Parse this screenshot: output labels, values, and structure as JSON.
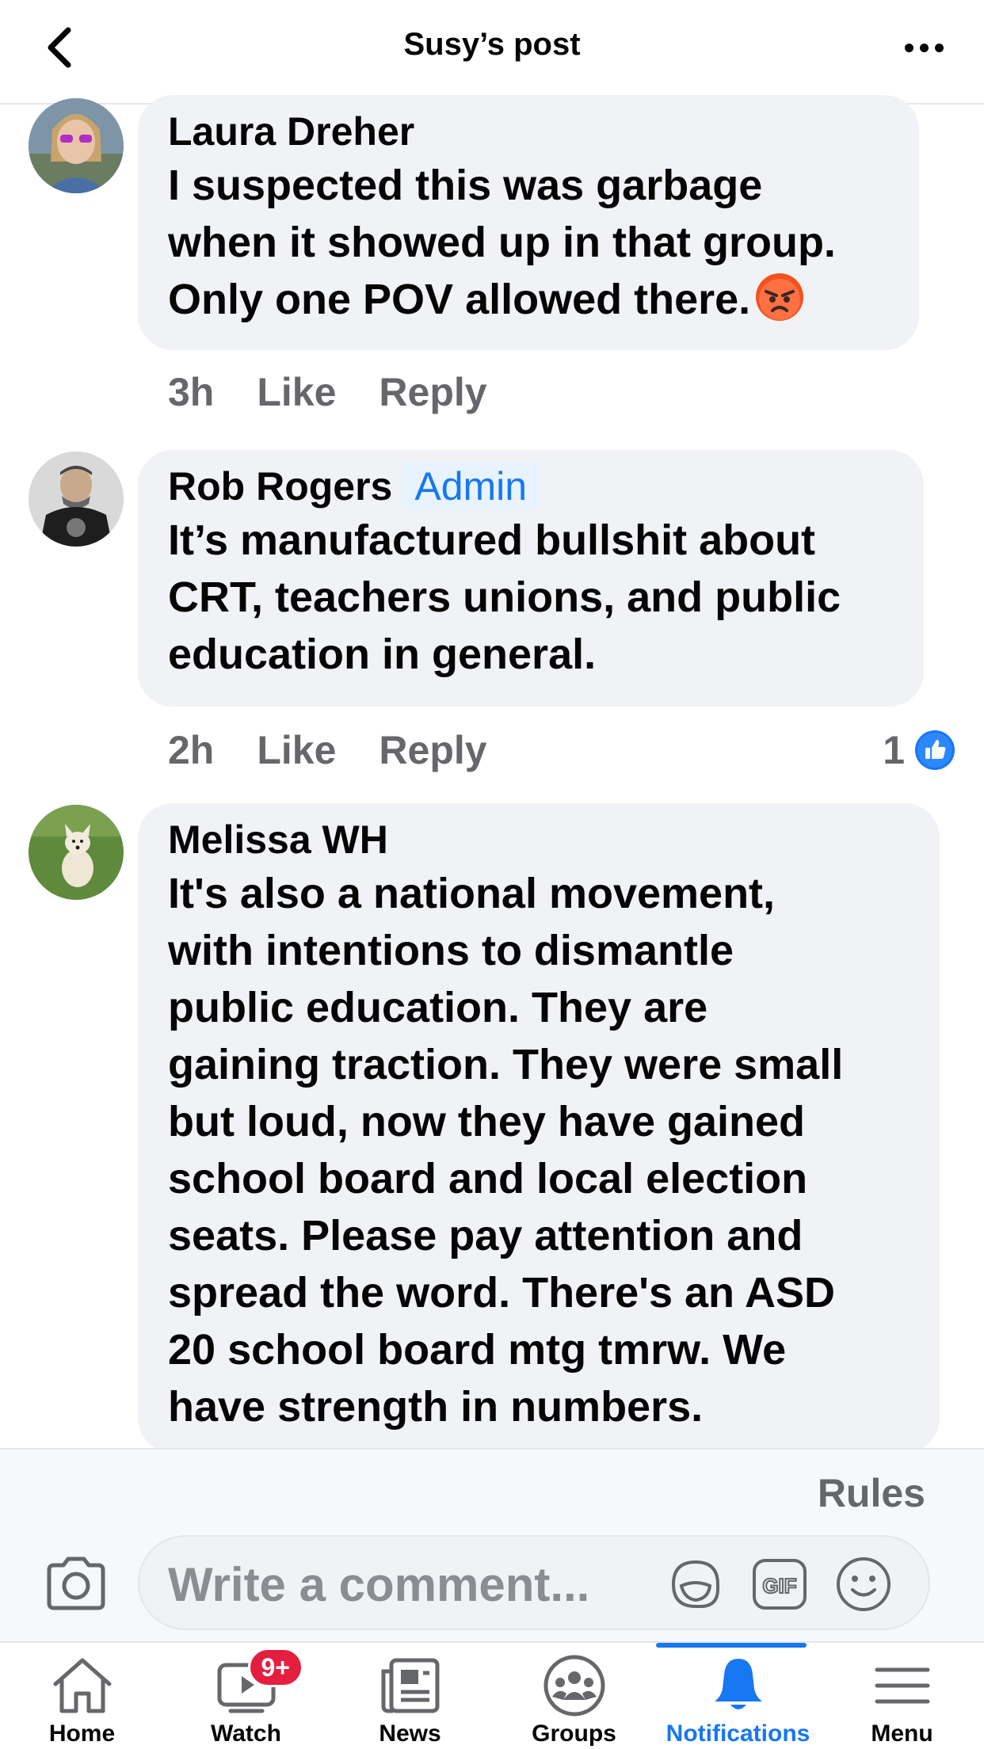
{
  "header": {
    "title": "Susy’s post"
  },
  "comments": [
    {
      "author": "Laura Dreher",
      "badge": "",
      "lines": [
        "I suspected this was garbage",
        "when it showed up in that group.",
        "Only one POV allowed there."
      ],
      "emoji": "angry-face",
      "time": "3h",
      "like_label": "Like",
      "reply_label": "Reply",
      "reaction_count": ""
    },
    {
      "author": "Rob Rogers",
      "badge": "Admin",
      "lines": [
        "It’s manufactured bullshit about",
        "CRT, teachers unions, and public",
        "education in general."
      ],
      "time": "2h",
      "like_label": "Like",
      "reply_label": "Reply",
      "reaction_count": "1"
    },
    {
      "author": "Melissa WH",
      "badge": "",
      "lines": [
        "It's also a national movement,",
        "with intentions to dismantle",
        "public education.  They are",
        "gaining traction.  They were small",
        "but loud,  now they have gained",
        "school board and local election",
        "seats.  Please pay attention and",
        "spread the word.  There's an ASD",
        "20 school board mtg tmrw.  We",
        "have strength in numbers."
      ]
    }
  ],
  "composer": {
    "rules_label": "Rules",
    "placeholder": "Write a comment..."
  },
  "tabs": [
    {
      "label": "Home",
      "icon": "home-icon"
    },
    {
      "label": "Watch",
      "icon": "watch-icon",
      "badge": "9+"
    },
    {
      "label": "News",
      "icon": "news-icon"
    },
    {
      "label": "Groups",
      "icon": "groups-icon"
    },
    {
      "label": "Notifications",
      "icon": "bell-icon",
      "active": true
    },
    {
      "label": "Menu",
      "icon": "menu-icon"
    }
  ],
  "colors": {
    "accent": "#1877f2",
    "bubble": "#f0f2f5",
    "meta": "#65676b",
    "badge_red": "#e41e3f"
  }
}
